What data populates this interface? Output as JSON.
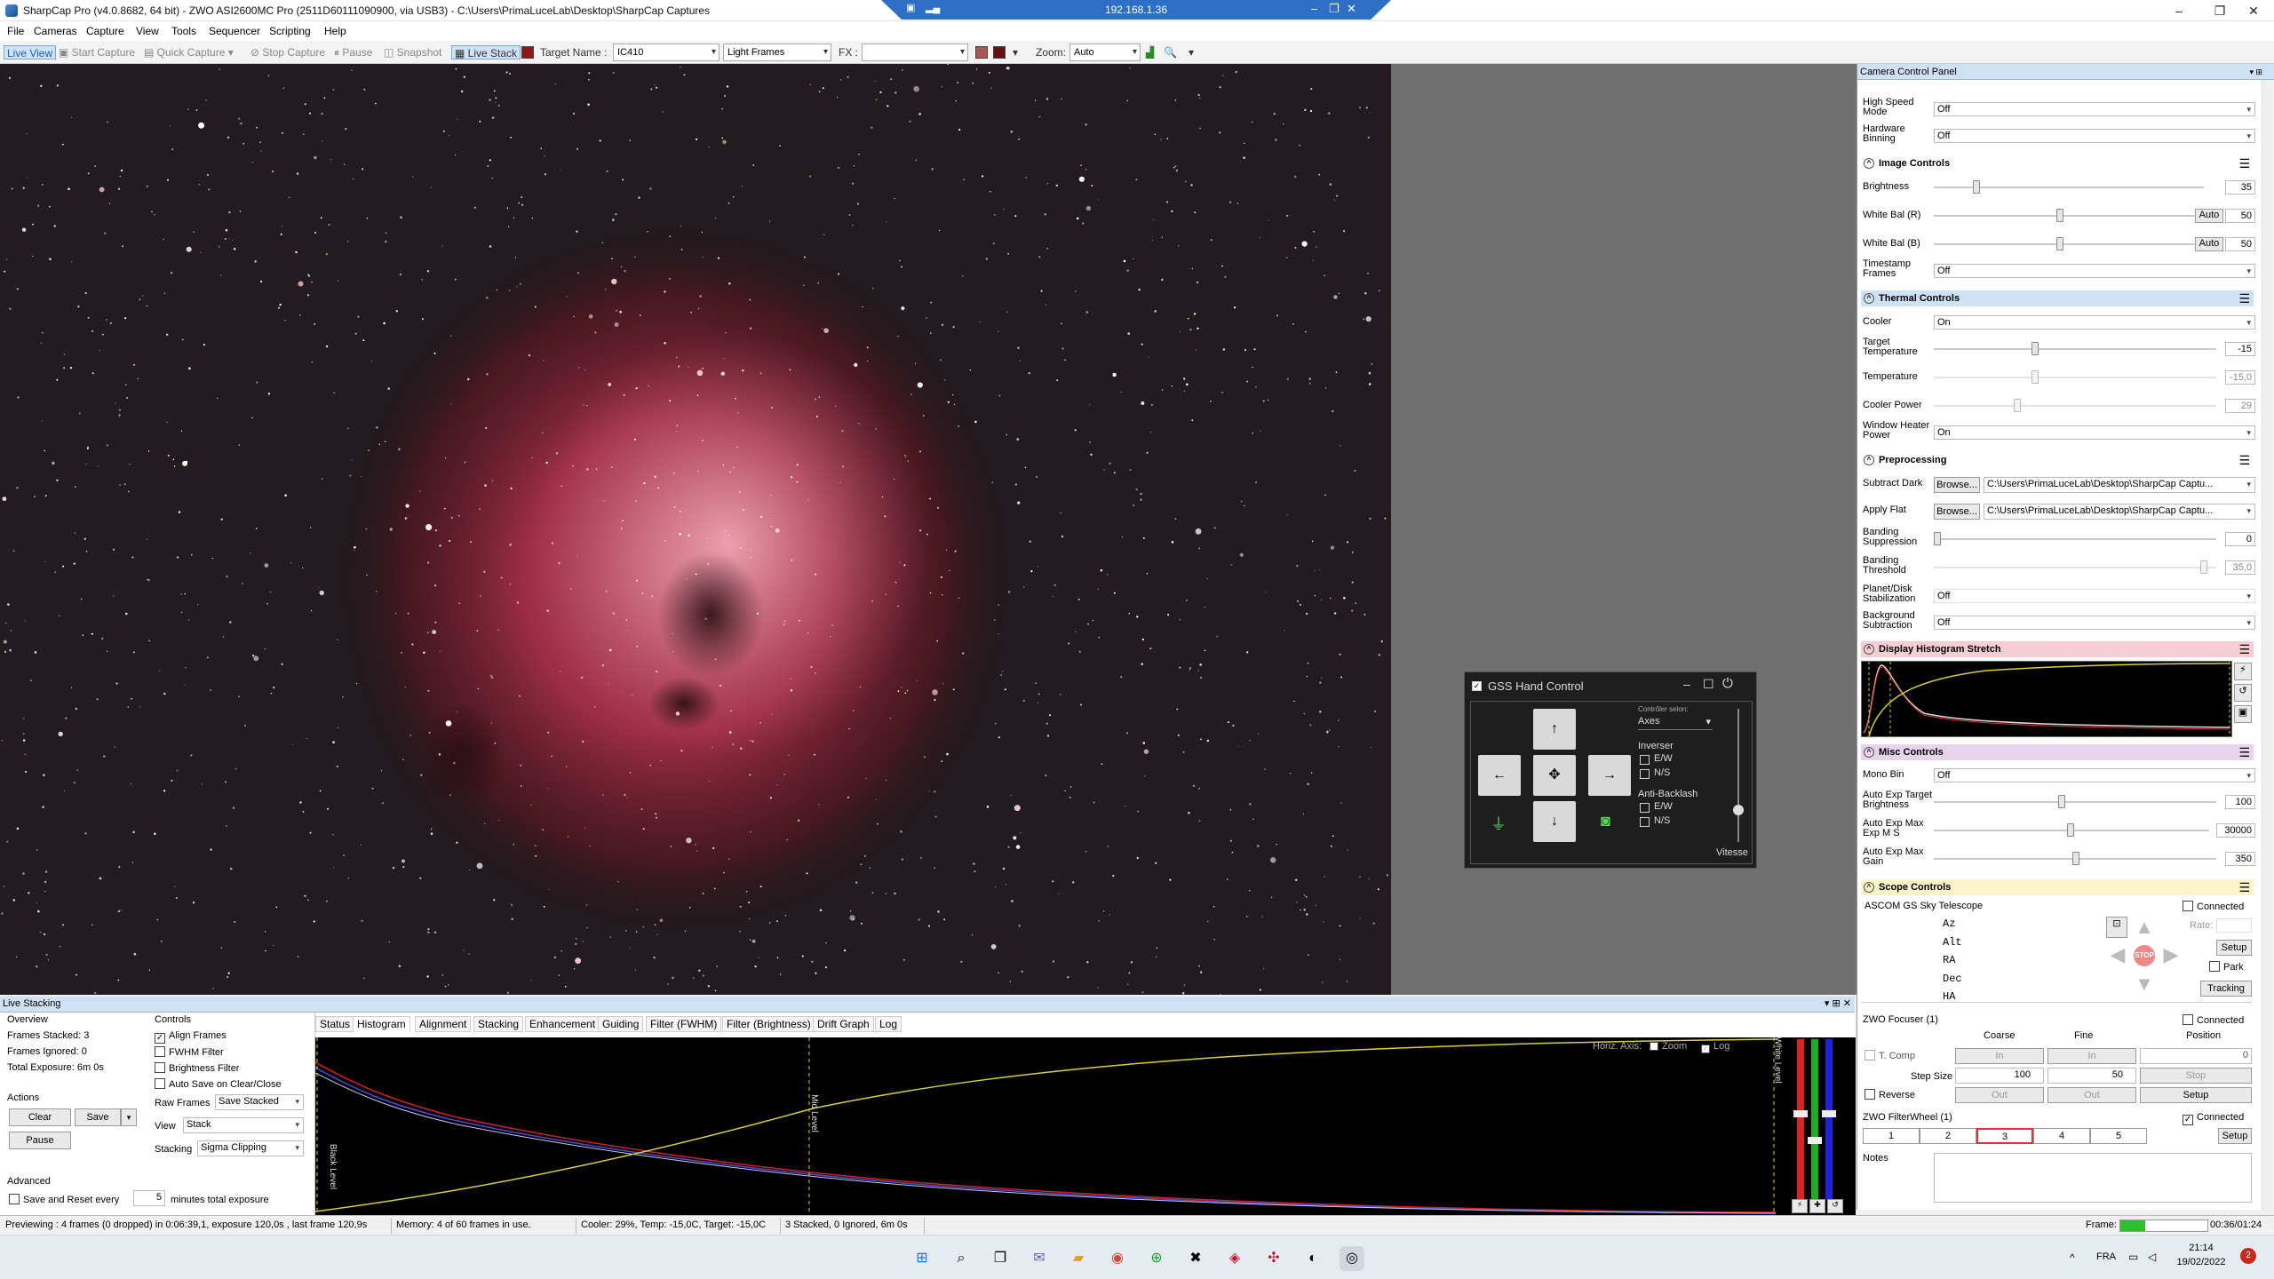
{
  "window": {
    "title": "SharpCap Pro (v4.0.8682, 64 bit) - ZWO ASI2600MC Pro (2511D60111090900, via USB3) - C:\\Users\\PrimaLuceLab\\Desktop\\SharpCap Captures"
  },
  "remote": {
    "ip": "192.168.1.36"
  },
  "menu": [
    "File",
    "Cameras",
    "Capture",
    "View",
    "Tools",
    "Sequencer",
    "Scripting",
    "Help"
  ],
  "toolbar": {
    "live_view": "Live View",
    "start_capture": "Start Capture",
    "quick_capture": "Quick Capture",
    "stop_capture": "Stop Capture",
    "pause": "Pause",
    "snapshot": "Snapshot",
    "live_stack": "Live Stack",
    "target_label": "Target Name :",
    "target_value": "IC410",
    "frames_value": "Light Frames",
    "fx_label": "FX :",
    "zoom_label": "Zoom:",
    "zoom_value": "Auto"
  },
  "ccp": {
    "title": "Camera Control Panel",
    "top_rows": [
      {
        "label": "High Speed Mode",
        "value": "Off"
      },
      {
        "label": "Hardware Binning",
        "value": "Off"
      }
    ],
    "image_controls": {
      "title": "Image Controls",
      "brightness": {
        "label": "Brightness",
        "value": "35"
      },
      "wb_r": {
        "label": "White Bal (R)",
        "auto": "Auto",
        "value": "50"
      },
      "wb_b": {
        "label": "White Bal (B)",
        "auto": "Auto",
        "value": "50"
      },
      "timestamp": {
        "label": "Timestamp Frames",
        "value": "Off"
      }
    },
    "thermal": {
      "title": "Thermal Controls",
      "cooler": {
        "label": "Cooler",
        "value": "On"
      },
      "target_temp": {
        "label": "Target Temperature",
        "value": "-15"
      },
      "temperature": {
        "label": "Temperature",
        "value": "-15,0"
      },
      "cooler_power": {
        "label": "Cooler Power",
        "value": "29"
      },
      "window_heater": {
        "label": "Window Heater Power",
        "value": "On"
      }
    },
    "preprocessing": {
      "title": "Preprocessing",
      "subtract_dark": {
        "label": "Subtract Dark",
        "browse": "Browse...",
        "path": "C:\\Users\\PrimaLuceLab\\Desktop\\SharpCap Captu..."
      },
      "apply_flat": {
        "label": "Apply Flat",
        "browse": "Browse...",
        "path": "C:\\Users\\PrimaLuceLab\\Desktop\\SharpCap Captu..."
      },
      "banding_supp": {
        "label": "Banding Suppression",
        "value": "0"
      },
      "banding_thr": {
        "label": "Banding Threshold",
        "value": "35,0"
      },
      "planet": {
        "label": "Planet/Disk Stabilization",
        "value": "Off"
      },
      "background": {
        "label": "Background Subtraction",
        "value": "Off"
      }
    },
    "histogram": {
      "title": "Display Histogram Stretch"
    },
    "misc": {
      "title": "Misc Controls",
      "mono_bin": {
        "label": "Mono Bin",
        "value": "Off"
      },
      "ae_target": {
        "label": "Auto Exp Target Brightness",
        "value": "100"
      },
      "ae_max_exp": {
        "label": "Auto Exp Max Exp M S",
        "value": "30000"
      },
      "ae_max_gain": {
        "label": "Auto Exp Max Gain",
        "value": "350"
      }
    },
    "scope": {
      "title": "Scope Controls",
      "name": "ASCOM GS Sky Telescope",
      "connected": "Connected",
      "axes": [
        "Az",
        "Alt",
        "RA",
        "Dec",
        "HA"
      ],
      "rate": "Rate:",
      "setup": "Setup",
      "park": "Park",
      "tracking": "Tracking",
      "stop": "STOP"
    },
    "focuser": {
      "title": "ZWO Focuser (1)",
      "connected": "Connected",
      "coarse": "Coarse",
      "fine": "Fine",
      "position": "Position",
      "tcomp": "T. Comp",
      "in": "In",
      "pos_value": "0",
      "step_size": "Step Size",
      "coarse_step": "100",
      "fine_step": "50",
      "stop": "Stop",
      "reverse": "Reverse",
      "out": "Out",
      "setup": "Setup"
    },
    "filterwheel": {
      "title": "ZWO FilterWheel (1)",
      "connected": "Connected",
      "slots": [
        "1",
        "2",
        "3",
        "4",
        "5"
      ],
      "setup": "Setup"
    },
    "notes": "Notes"
  },
  "gss": {
    "title": "GSS Hand Control",
    "controller_label": "Contrôler selon:",
    "controller_value": "Axes",
    "inverser": "Inverser",
    "ew": "E/W",
    "ns": "N/S",
    "antibacklash": "Anti-Backlash",
    "vitesse": "Vitesse"
  },
  "live_stacking": {
    "title": "Live Stacking",
    "overview": "Overview",
    "frames_stacked": "Frames Stacked: 3",
    "frames_ignored": "Frames Ignored: 0",
    "total_exposure": "Total Exposure:  6m 0s",
    "actions": "Actions",
    "clear": "Clear",
    "save": "Save",
    "pause": "Pause",
    "advanced": "Advanced",
    "save_reset": "Save and Reset every",
    "minutes_value": "5",
    "minutes_label": "minutes total exposure",
    "controls": "Controls",
    "align": "Align Frames",
    "fwhm": "FWHM Filter",
    "brightness": "Brightness Filter",
    "autosave": "Auto Save on Clear/Close",
    "raw_frames": "Raw Frames",
    "raw_value": "Save Stacked",
    "view": "View",
    "view_value": "Stack",
    "stacking": "Stacking",
    "stacking_value": "Sigma Clipping",
    "tabs": [
      "Status",
      "Histogram",
      "Alignment",
      "Stacking",
      "Enhancement",
      "Guiding",
      "Filter (FWHM)",
      "Filter (Brightness)",
      "Drift Graph",
      "Log"
    ],
    "horiz_axis": "Horiz. Axis:",
    "zoom": "Zoom",
    "log": "Log",
    "black_level": "Black Level",
    "mid_level": "Mid Level",
    "white_level": "White Level"
  },
  "status": {
    "preview": "Previewing : 4 frames (0 dropped) in 0:06:39,1, exposure 120,0s , last frame 120,9s",
    "memory": "Memory: 4 of 60 frames in use.",
    "cooler": "Cooler: 29%, Temp: -15,0C, Target: -15,0C",
    "stacked": "3 Stacked, 0 Ignored, 6m 0s",
    "frame_label": "Frame:",
    "time": "00:36/01:24"
  },
  "taskbar": {
    "lang": "FRA",
    "clock": "21:14",
    "date": "19/02/2022",
    "badge": "2"
  }
}
